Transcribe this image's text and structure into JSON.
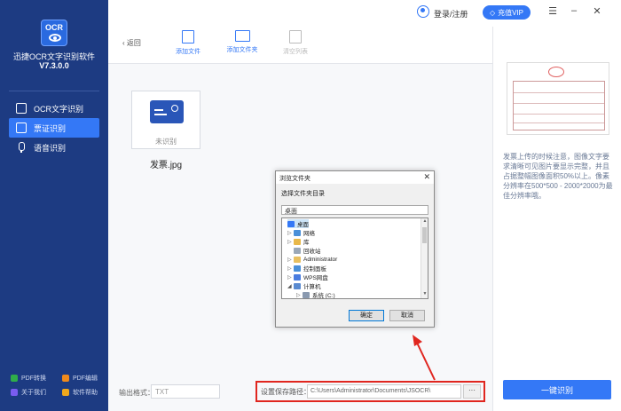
{
  "app": {
    "title": "迅捷OCR文字识别软件",
    "version": "V7.3.0.0",
    "logo_text": "OCR"
  },
  "sidebar": {
    "items": [
      {
        "label": "OCR文字识别",
        "icon": "scan-icon",
        "active": false
      },
      {
        "label": "票证识别",
        "icon": "card-icon",
        "active": true
      },
      {
        "label": "语音识别",
        "icon": "mic-icon",
        "active": false
      }
    ],
    "footer": [
      {
        "label": "PDF转换",
        "color": "#2fae4a"
      },
      {
        "label": "PDF编辑",
        "color": "#f08a1c"
      },
      {
        "label": "关于我们",
        "color": "#7a5cf0"
      },
      {
        "label": "软件帮助",
        "color": "#f0a81c"
      }
    ]
  },
  "header": {
    "login": "登录/注册",
    "vip": "充值VIP",
    "controls": [
      "☰",
      "–",
      "✕"
    ]
  },
  "toolbar": {
    "back": "‹ 返回",
    "add_file": "添加文件",
    "add_folder": "添加文件夹",
    "clear_list": "清空列表"
  },
  "file": {
    "status": "未识别",
    "name": "发票.jpg"
  },
  "output": {
    "label": "输出格式：",
    "value": "TXT"
  },
  "save": {
    "label": "设置保存路径：",
    "path": "C:\\Users\\Administrator\\Documents\\JSOCR\\",
    "browse": "···"
  },
  "right_panel": {
    "tip": "发票上传的时候注意，图像文字要求清晰可见图片要显示完整，并且占据整幅图像面积50%以上。像素分辨率在500*500 - 2000*2000为最佳分辨率哦。",
    "recognize": "一键识别"
  },
  "dialog": {
    "title": "浏览文件夹",
    "close": "✕",
    "prompt": "选择文件夹目录",
    "path": "桌面",
    "tree": [
      {
        "label": "桌面",
        "depth": 0,
        "exp": "",
        "color": "#3478f6",
        "selected": true
      },
      {
        "label": "网络",
        "depth": 1,
        "exp": "▷",
        "color": "#4a90d9",
        "selected": false
      },
      {
        "label": "库",
        "depth": 1,
        "exp": "▷",
        "color": "#e8b84a",
        "selected": false
      },
      {
        "label": "回收站",
        "depth": 1,
        "exp": "",
        "color": "#9aa8b8",
        "selected": false
      },
      {
        "label": "Administrator",
        "depth": 1,
        "exp": "▷",
        "color": "#e8c060",
        "selected": false
      },
      {
        "label": "控制面板",
        "depth": 1,
        "exp": "▷",
        "color": "#4a90d9",
        "selected": false
      },
      {
        "label": "WPS网盘",
        "depth": 1,
        "exp": "▷",
        "color": "#4a7de0",
        "selected": false
      },
      {
        "label": "计算机",
        "depth": 1,
        "exp": "◢",
        "color": "#5a8ad0",
        "selected": false
      },
      {
        "label": "系统 (C:)",
        "depth": 2,
        "exp": "▷",
        "color": "#8a9ab0",
        "selected": false
      }
    ],
    "ok": "确定",
    "cancel": "取消"
  }
}
